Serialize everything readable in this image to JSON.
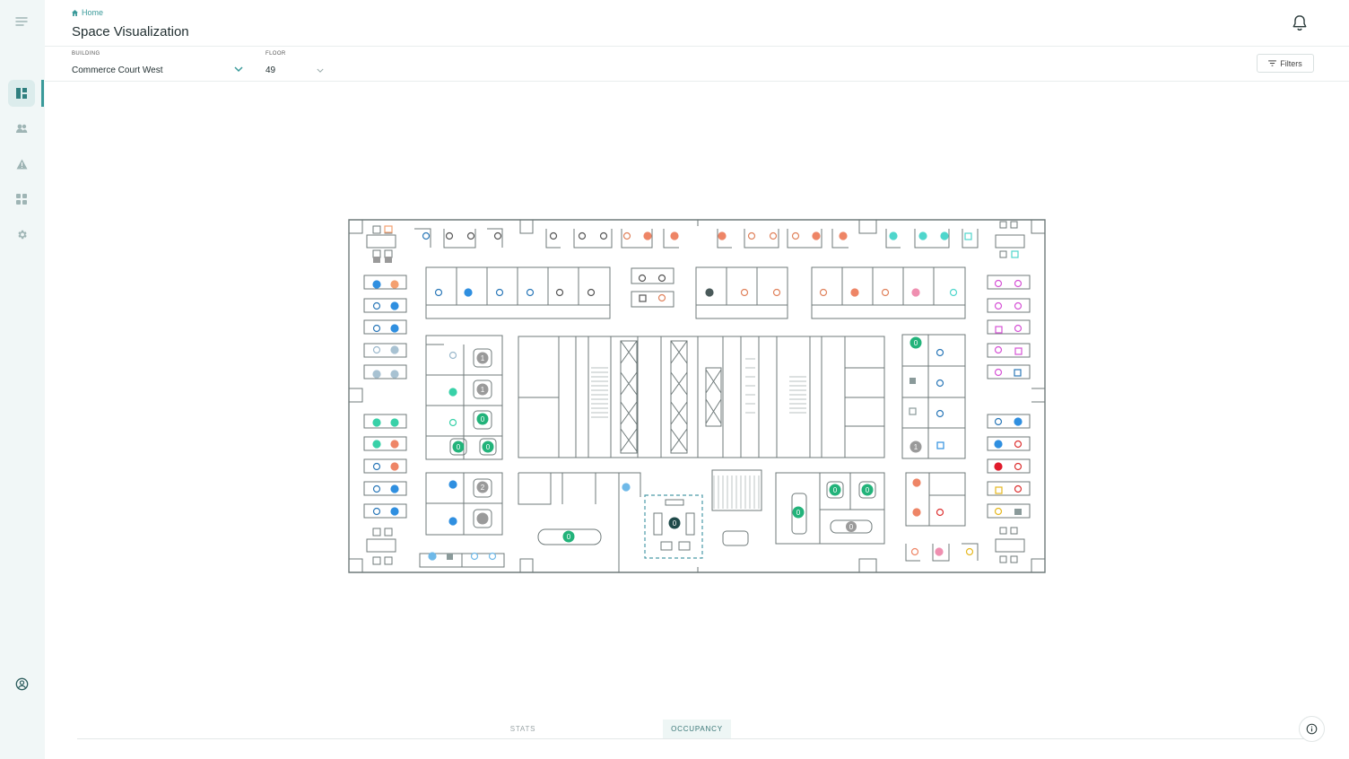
{
  "breadcrumb": {
    "home_label": "Home"
  },
  "page": {
    "title": "Space Visualization"
  },
  "toolbar": {
    "building_label": "BUILDING",
    "building_value": "Commerce Court West",
    "floor_label": "FLOOR",
    "floor_value": "49",
    "filters_label": "Filters"
  },
  "sidebar": {
    "items": [
      {
        "icon": "menu-icon"
      },
      {
        "icon": "dashboard-icon",
        "active": true
      },
      {
        "icon": "users-icon"
      },
      {
        "icon": "warning-icon"
      },
      {
        "icon": "apps-icon"
      },
      {
        "icon": "gear-icon"
      },
      {
        "icon": "account-icon"
      }
    ]
  },
  "tabs": [
    {
      "label": "STATS",
      "active": false
    },
    {
      "label": "OCCUPANCY",
      "active": true
    }
  ],
  "floorplan": {
    "occupancy_badges": [
      "0",
      "1",
      "1",
      "0",
      "0",
      "0",
      "2",
      "0",
      "0",
      "0",
      "0",
      "0",
      "0",
      "0",
      "1"
    ],
    "badge_colors": {
      "available": "#22b37a",
      "in_use": "#9a9a9a",
      "selected": "#1f4a4a"
    }
  },
  "colors": {
    "accent": "#3a9a9a",
    "sidebar_bg": "#f1f7f7"
  }
}
